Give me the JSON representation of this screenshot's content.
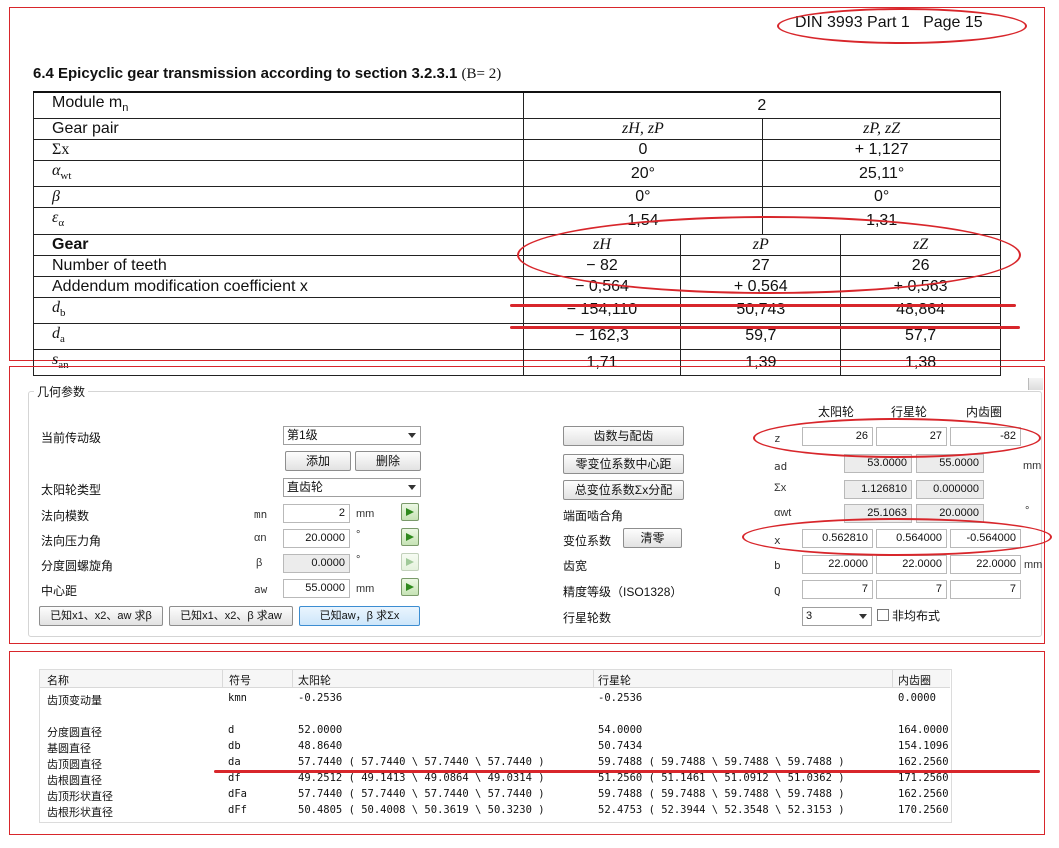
{
  "doc": {
    "header": "DIN 3993 Part 1   Page 15",
    "section_title": "6.4  Epicyclic gear transmission according to section 3.2.3.1",
    "section_param": "(B= 2)",
    "rows": [
      {
        "label": "Module m",
        "sub": "n",
        "span": "2"
      },
      {
        "label": "Gear pair",
        "pair1": "zH, zP",
        "pair2": "zP, zZ"
      },
      {
        "label": "Σx",
        "pair1": "0",
        "pair2": "+ 1,127"
      },
      {
        "label": "α",
        "sub": "wt",
        "pair1": "20°",
        "pair2": "25,11°"
      },
      {
        "label": "β",
        "pair1": "0°",
        "pair2": "0°"
      },
      {
        "label": "ε",
        "sub": "α",
        "pair1": "1,54",
        "pair2": "1,31"
      },
      {
        "label": "Gear",
        "c1": "zH",
        "c2": "zP",
        "c3": "zZ"
      },
      {
        "label": "Number of teeth",
        "c1": "− 82",
        "c2": "27",
        "c3": "26"
      },
      {
        "label": "Addendum modification coefficient x",
        "c1": "− 0,564",
        "c2": "+ 0,564",
        "c3": "+ 0,563"
      },
      {
        "label": "d",
        "sub": "b",
        "c1": "− 154,110",
        "c2": "50,743",
        "c3": "48,864"
      },
      {
        "label": "d",
        "sub": "a",
        "c1": "− 162,3",
        "c2": "59,7",
        "c3": "57,7"
      },
      {
        "label": "s",
        "sub": "an",
        "c1": "1,71",
        "c2": "1,39",
        "c3": "1,38"
      }
    ]
  },
  "dialog": {
    "group_title": "几何参数",
    "col_headers": [
      "太阳轮",
      "行星轮",
      "内齿圈"
    ],
    "stage_label": "当前传动级",
    "stage_value": "第1级",
    "add_btn": "添加",
    "delete_btn": "删除",
    "sun_type_label": "太阳轮类型",
    "sun_type_value": "直齿轮",
    "module_label": "法向模数",
    "module_sym": "mn",
    "module_value": "2",
    "module_unit": "mm",
    "pressure_label": "法向压力角",
    "pressure_sym": "αn",
    "pressure_value": "20.0000",
    "pressure_unit": "°",
    "helix_label": "分度圆螺旋角",
    "helix_sym": "β",
    "helix_value": "0.0000",
    "helix_unit": "°",
    "center_label": "中心距",
    "center_sym": "aw",
    "center_value": "55.0000",
    "center_unit": "mm",
    "calc_btn1": "已知x1、x2、aw 求β",
    "calc_btn2": "已知x1、x2、β 求aw",
    "calc_btn3": "已知aw，β 求Σx",
    "teeth_btn": "齿数与配齿",
    "zero_shift_btn": "零变位系数中心距",
    "total_shift_btn": "总变位系数Σx分配",
    "end_contact_label": "端面啮合角",
    "shift_label": "变位系数",
    "clear_btn": "清零",
    "width_label": "齿宽",
    "accuracy_label": "精度等级（ISO1328）",
    "planet_count_label": "行星轮数",
    "planet_count_value": "3",
    "nonuniform_label": "非均布式",
    "right_rows": [
      {
        "sym": "z",
        "v": [
          "26",
          "27",
          "-82"
        ],
        "unit": ""
      },
      {
        "sym": "ad",
        "v": [
          "53.0000",
          "55.0000"
        ],
        "unit": "mm"
      },
      {
        "sym": "Σx",
        "v": [
          "1.126810",
          "0.000000"
        ],
        "unit": ""
      },
      {
        "sym": "αwt",
        "v": [
          "25.1063",
          "20.0000"
        ],
        "unit": "°"
      },
      {
        "sym": "x",
        "v": [
          "0.562810",
          "0.564000",
          "-0.564000"
        ],
        "unit": ""
      },
      {
        "sym": "b",
        "v": [
          "22.0000",
          "22.0000",
          "22.0000"
        ],
        "unit": "mm"
      },
      {
        "sym": "Q",
        "v": [
          "7",
          "7",
          "7"
        ],
        "unit": ""
      }
    ]
  },
  "results": {
    "headers": [
      "名称",
      "符号",
      "太阳轮",
      "行星轮",
      "内齿圈"
    ],
    "rows": [
      {
        "name": "齿顶变动量",
        "sym": "kmn",
        "sun": "-0.2536",
        "planet": "-0.2536",
        "ring": "0.0000"
      },
      {
        "name": "",
        "sym": "",
        "sun": "",
        "planet": "",
        "ring": ""
      },
      {
        "name": "分度圆直径",
        "sym": "d",
        "sun": "52.0000",
        "planet": "54.0000",
        "ring": "164.0000"
      },
      {
        "name": "基圆直径",
        "sym": "db",
        "sun": "48.8640",
        "planet": "50.7434",
        "ring": "154.1096"
      },
      {
        "name": "齿顶圆直径",
        "sym": "da",
        "sun": "57.7440 ( 57.7440 \\ 57.7440 \\ 57.7440 )",
        "planet": "59.7488 ( 59.7488 \\ 59.7488 \\ 59.7488 )",
        "ring": "162.2560 ("
      },
      {
        "name": "齿根圆直径",
        "sym": "df",
        "sun": "49.2512 ( 49.1413 \\ 49.0864 \\ 49.0314 )",
        "planet": "51.2560 ( 51.1461 \\ 51.0912 \\ 51.0362 )",
        "ring": "171.2560 ("
      },
      {
        "name": "齿顶形状直径",
        "sym": "dFa",
        "sun": "57.7440 ( 57.7440 \\ 57.7440 \\ 57.7440 )",
        "planet": "59.7488 ( 59.7488 \\ 59.7488 \\ 59.7488 )",
        "ring": "162.2560 ("
      },
      {
        "name": "齿根形状直径",
        "sym": "dFf",
        "sun": "50.4805 ( 50.4008 \\ 50.3619 \\ 50.3230 )",
        "planet": "52.4753 ( 52.3944 \\ 52.3548 \\ 52.3153 )",
        "ring": "170.2560 ("
      }
    ]
  },
  "colors": {
    "annotation": "#d8262b",
    "accent_button": "#3c8dd1"
  }
}
